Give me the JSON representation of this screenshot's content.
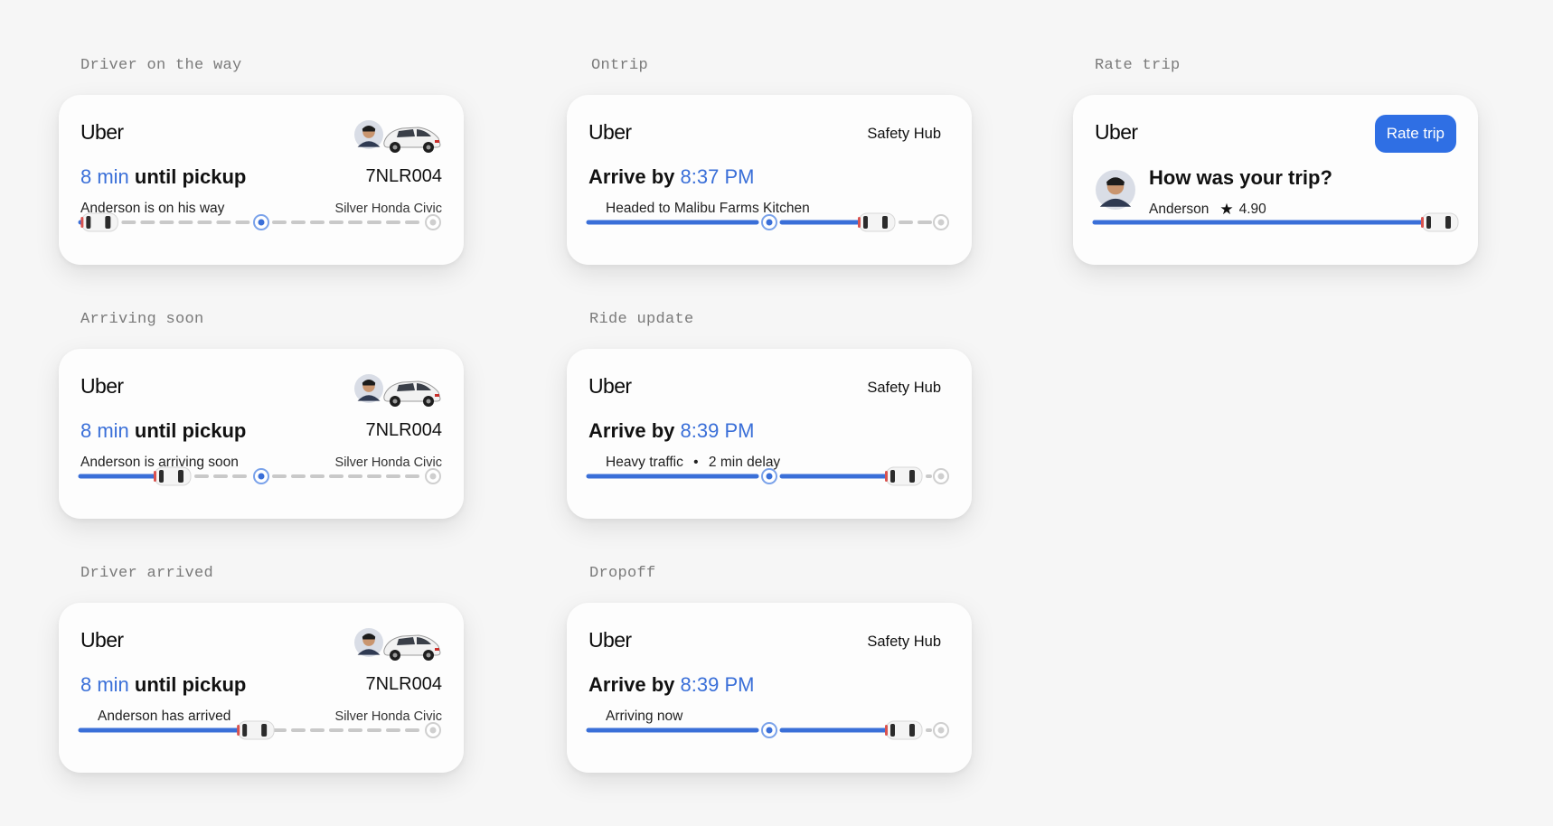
{
  "labels": {
    "driver_on_way": "Driver on the way",
    "ontrip": "Ontrip",
    "rate_trip": "Rate trip",
    "arriving_soon": "Arriving soon",
    "ride_update": "Ride update",
    "driver_arrived": "Driver arrived",
    "dropoff": "Dropoff"
  },
  "colors": {
    "accent": "#3a6fd8",
    "track_fill": "#3a6fd8",
    "track_dash": "#c9c9c9",
    "button": "#2f6fe4"
  },
  "icons": {
    "driver_avatar": "driver-avatar-icon",
    "car": "car-icon",
    "star": "star-icon",
    "safety": "safety-hub-label"
  },
  "cards": {
    "driver_on_way": {
      "brand": "Uber",
      "eta_value": "8 min",
      "eta_label": "until pickup",
      "status": "Anderson is on his way",
      "plate": "7NLR004",
      "model": "Silver Honda Civic",
      "progress": 0.04
    },
    "arriving_soon": {
      "brand": "Uber",
      "eta_value": "8 min",
      "eta_label": "until pickup",
      "status": "Anderson is arriving soon",
      "plate": "7NLR004",
      "model": "Silver Honda Civic",
      "progress": 0.25
    },
    "driver_arrived": {
      "brand": "Uber",
      "eta_value": "8 min",
      "eta_label": "until pickup",
      "status": "Anderson has arrived",
      "plate": "7NLR004",
      "model": "Silver Honda Civic",
      "progress": 0.49
    },
    "ontrip": {
      "brand": "Uber",
      "safety": "Safety Hub",
      "arrive_label": "Arrive by",
      "arrive_time": "8:37 PM",
      "status": "Headed to Malibu Farms Kitchen",
      "progress": 0.7
    },
    "ride_update": {
      "brand": "Uber",
      "safety": "Safety Hub",
      "arrive_label": "Arrive by",
      "arrive_time": "8:39 PM",
      "status_a": "Heavy traffic",
      "status_sep": "•",
      "status_b": "2 min delay",
      "progress": 0.9
    },
    "dropoff": {
      "brand": "Uber",
      "safety": "Safety Hub",
      "arrive_label": "Arrive by",
      "arrive_time": "8:39 PM",
      "status": "Arriving now",
      "progress": 0.9
    },
    "rate_trip": {
      "brand": "Uber",
      "button": "Rate trip",
      "question": "How was your trip?",
      "driver": "Anderson",
      "rating": "4.90",
      "progress": 1.0
    }
  }
}
